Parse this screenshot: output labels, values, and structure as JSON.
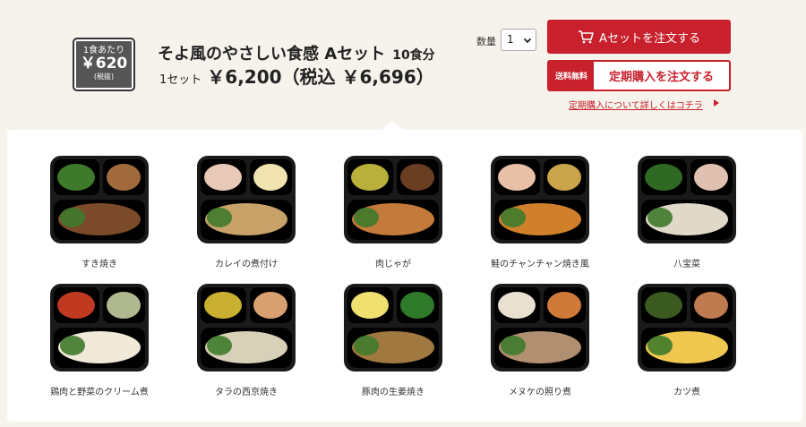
{
  "product": {
    "badge_label": "1食あたり",
    "badge_price": "￥620",
    "badge_note": "(税抜)",
    "title": "そよ風のやさしい食感 Aセット",
    "count": "10食分",
    "set_unit": "1セット",
    "set_price": "￥6,200（税込 ￥6,696）"
  },
  "quantity": {
    "label": "数量",
    "value": "1"
  },
  "buttons": {
    "order": "Aセットを注文する",
    "free_shipping": "送料無料",
    "subscribe": "定期購入を注文する",
    "subscribe_link": "定期購入について詳しくはコチラ"
  },
  "colors": {
    "accent": "#c8202c",
    "tray": "#1a1a1a",
    "badge": "#555555"
  },
  "icons": {
    "order": "cart-icon",
    "link": "caret-right-icon"
  },
  "items": [
    {
      "name": "すき焼き",
      "dishes": [
        "#3f7a2c",
        "#a06a3c",
        "#7a4a2a"
      ]
    },
    {
      "name": "カレイの煮付け",
      "dishes": [
        "#e8c9b8",
        "#f0e3b0",
        "#c9a26a"
      ]
    },
    {
      "name": "肉じゃが",
      "dishes": [
        "#b8b03a",
        "#6a3e22",
        "#c47a3a"
      ]
    },
    {
      "name": "鮭のチャンチャン焼き風",
      "dishes": [
        "#e8c0a8",
        "#c9a44a",
        "#d0802a"
      ]
    },
    {
      "name": "八宝菜",
      "dishes": [
        "#2f6a24",
        "#e0c0b0",
        "#e0d8c8"
      ]
    },
    {
      "name": "鶏肉と野菜のクリーム煮",
      "dishes": [
        "#c03a22",
        "#b0b890",
        "#f0e8d8"
      ]
    },
    {
      "name": "タラの西京焼き",
      "dishes": [
        "#c9b030",
        "#d8a070",
        "#d8d0b8"
      ]
    },
    {
      "name": "豚肉の生姜焼き",
      "dishes": [
        "#f0e070",
        "#2f7a2a",
        "#a07840"
      ]
    },
    {
      "name": "メヌケの照り煮",
      "dishes": [
        "#e8e0d0",
        "#d07a3a",
        "#b09070"
      ]
    },
    {
      "name": "カツ煮",
      "dishes": [
        "#3a5a20",
        "#c07a50",
        "#f0c850"
      ]
    }
  ]
}
